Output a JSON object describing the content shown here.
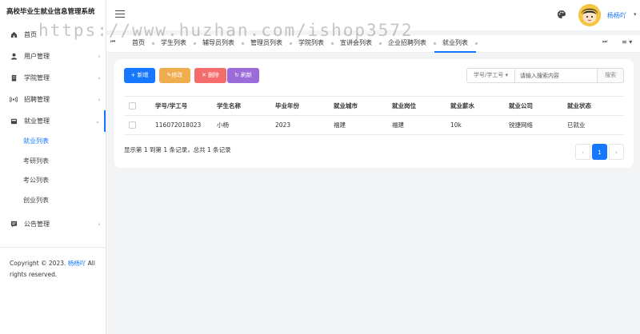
{
  "app": {
    "title": "高校毕业生就业信息管理系统"
  },
  "sidebar": {
    "items": [
      {
        "icon": "home-icon",
        "label": "首页",
        "has_arrow": false
      },
      {
        "icon": "user-icon",
        "label": "用户管理",
        "has_arrow": true
      },
      {
        "icon": "building-icon",
        "label": "学院管理",
        "has_arrow": true
      },
      {
        "icon": "broadcast-icon",
        "label": "招聘管理",
        "has_arrow": true
      },
      {
        "icon": "briefcase-icon",
        "label": "就业管理",
        "has_arrow": true,
        "open": true
      }
    ],
    "subitems": [
      {
        "label": "就业列表",
        "active": true
      },
      {
        "label": "考研列表"
      },
      {
        "label": "考公列表"
      },
      {
        "label": "创业列表"
      }
    ],
    "bottom_item": {
      "icon": "notice-icon",
      "label": "公告管理"
    },
    "copyright_prefix": "Copyright © 2023.",
    "copyright_author": "杨杨吖",
    "copyright_suffix": "All rights reserved."
  },
  "header": {
    "username": "杨杨吖"
  },
  "tabs": [
    {
      "label": "首页"
    },
    {
      "label": "学生列表"
    },
    {
      "label": "辅导员列表"
    },
    {
      "label": "管理员列表"
    },
    {
      "label": "学院列表"
    },
    {
      "label": "宣讲会列表"
    },
    {
      "label": "企业招聘列表"
    },
    {
      "label": "就业列表",
      "active": true
    }
  ],
  "watermark": "https://www.huzhan.com/ishop3572",
  "toolbar": {
    "add_label": "+ 新增",
    "edit_label": "✎修改",
    "delete_label": "✕ 删除",
    "refresh_label": "↻ 刷新",
    "search_field": "学号/学工号",
    "search_placeholder": "请输入搜索内容",
    "search_button": "搜索"
  },
  "table": {
    "columns": [
      "学号/学工号",
      "学生名称",
      "毕业年份",
      "就业城市",
      "就业岗位",
      "就业薪水",
      "就业公司",
      "就业状态"
    ],
    "rows": [
      [
        "116072018023",
        "小杨",
        "2023",
        "福建",
        "福建",
        "10k",
        "锐捷网络",
        "已就业"
      ]
    ]
  },
  "pagination": {
    "info": "显示第 1 到第 1 条记录，总共 1 条记录",
    "prev": "‹",
    "current": "1",
    "next": "›"
  },
  "colors": {
    "accent": "#1677ff",
    "edit": "#f0ad4e",
    "delete": "#f56c6c",
    "refresh": "#9b6bd8"
  }
}
